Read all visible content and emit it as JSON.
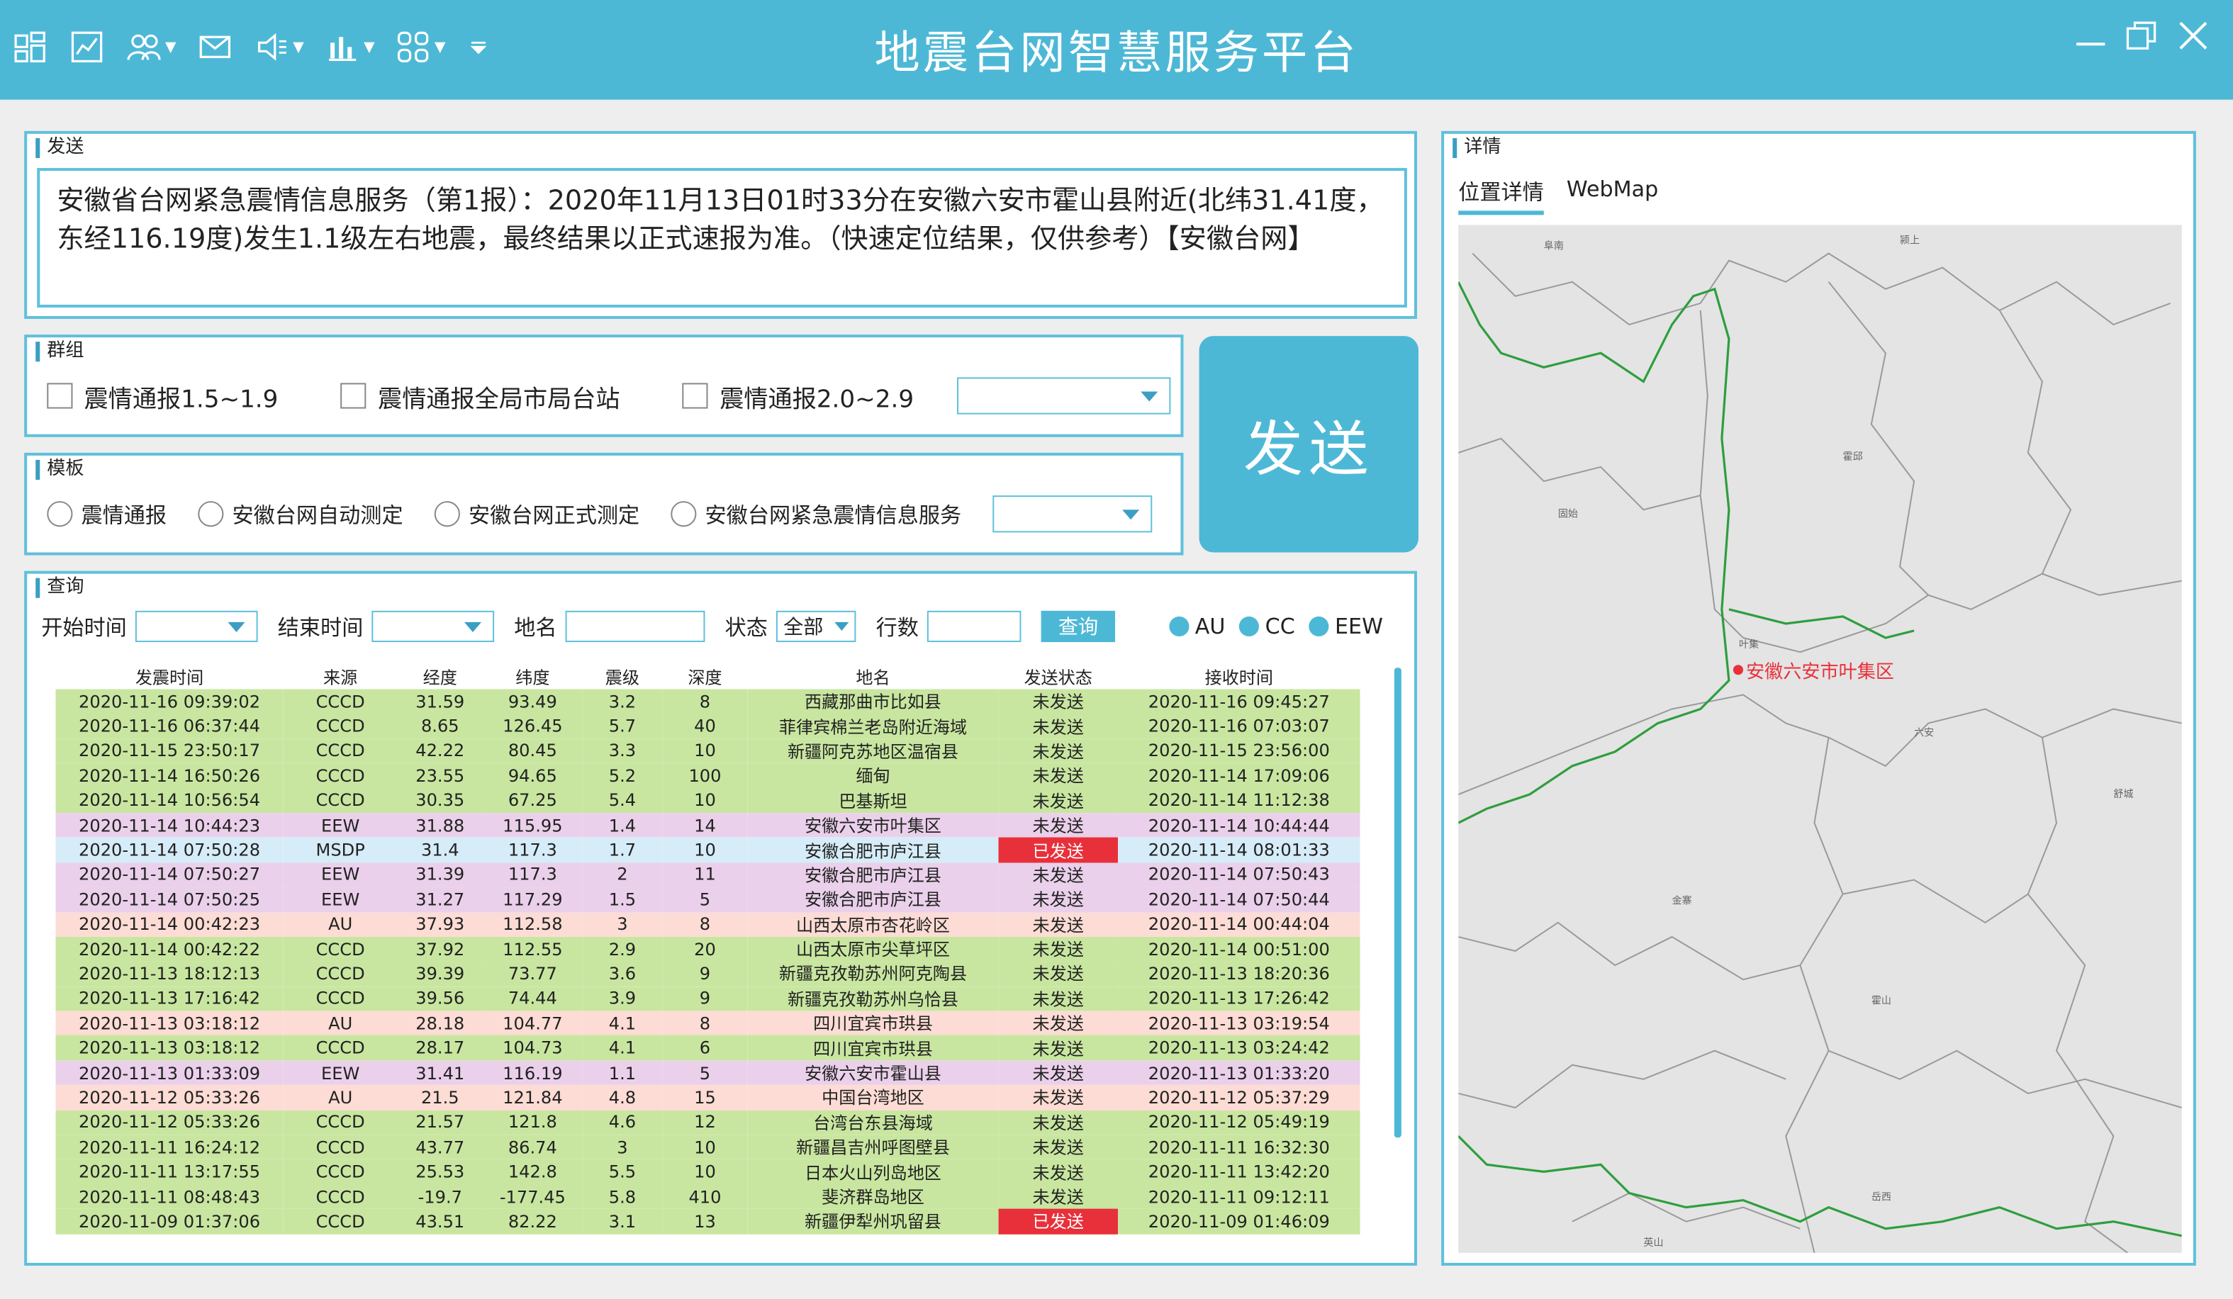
{
  "app": {
    "title": "地震台网智慧服务平台",
    "accent_color": "#4db8d6",
    "toolbar_icons": [
      "layout-icon",
      "chart-icon",
      "users-icon",
      "mail-icon",
      "speaker-icon",
      "bar-chart-icon",
      "grid-icon",
      "dropdown-icon"
    ]
  },
  "send_panel": {
    "title": "发送",
    "message": "安徽省台网紧急震情信息服务（第1报）：2020年11月13日01时33分在安徽六安市霍山县附近(北纬31.41度，东经116.19度)发生1.1级左右地震，最终结果以正式速报为准。（快速定位结果，仅供参考）【安徽台网】"
  },
  "group_panel": {
    "title": "群组",
    "options": [
      "震情通报1.5~1.9",
      "震情通报全局市局台站",
      "震情通报2.0~2.9"
    ]
  },
  "template_panel": {
    "title": "模板",
    "options": [
      "震情通报",
      "安徽台网自动测定",
      "安徽台网正式测定",
      "安徽台网紧急震情信息服务"
    ]
  },
  "send_button": {
    "label": "发送"
  },
  "query_panel": {
    "title": "查询",
    "start_label": "开始时间",
    "end_label": "结束时间",
    "place_label": "地名",
    "state_label": "状态",
    "state_value": "全部",
    "rows_label": "行数",
    "query_button": "查询",
    "legend": [
      "AU",
      "CC",
      "EEW"
    ]
  },
  "table": {
    "columns": [
      "发震时间",
      "来源",
      "经度",
      "纬度",
      "震级",
      "深度",
      "地名",
      "发送状态",
      "接收时间"
    ],
    "rows": [
      [
        "2020-11-16 09:39:02",
        "CCCD",
        "31.59",
        "93.49",
        "3.2",
        "8",
        "西藏那曲市比如县",
        "未发送",
        "2020-11-16 09:45:27"
      ],
      [
        "2020-11-16 06:37:44",
        "CCCD",
        "8.65",
        "126.45",
        "5.7",
        "40",
        "菲律宾棉兰老岛附近海域",
        "未发送",
        "2020-11-16 07:03:07"
      ],
      [
        "2020-11-15 23:50:17",
        "CCCD",
        "42.22",
        "80.45",
        "3.3",
        "10",
        "新疆阿克苏地区温宿县",
        "未发送",
        "2020-11-15 23:56:00"
      ],
      [
        "2020-11-14 16:50:26",
        "CCCD",
        "23.55",
        "94.65",
        "5.2",
        "100",
        "缅甸",
        "未发送",
        "2020-11-14 17:09:06"
      ],
      [
        "2020-11-14 10:56:54",
        "CCCD",
        "30.35",
        "67.25",
        "5.4",
        "10",
        "巴基斯坦",
        "未发送",
        "2020-11-14 11:12:38"
      ],
      [
        "2020-11-14 10:44:23",
        "EEW",
        "31.88",
        "115.95",
        "1.4",
        "14",
        "安徽六安市叶集区",
        "未发送",
        "2020-11-14 10:44:44"
      ],
      [
        "2020-11-14 07:50:28",
        "MSDP",
        "31.4",
        "117.3",
        "1.7",
        "10",
        "安徽合肥市庐江县",
        "已发送",
        "2020-11-14 08:01:33"
      ],
      [
        "2020-11-14 07:50:27",
        "EEW",
        "31.39",
        "117.3",
        "2",
        "11",
        "安徽合肥市庐江县",
        "未发送",
        "2020-11-14 07:50:43"
      ],
      [
        "2020-11-14 07:50:25",
        "EEW",
        "31.27",
        "117.29",
        "1.5",
        "5",
        "安徽合肥市庐江县",
        "未发送",
        "2020-11-14 07:50:44"
      ],
      [
        "2020-11-14 00:42:23",
        "AU",
        "37.93",
        "112.58",
        "3",
        "8",
        "山西太原市杏花岭区",
        "未发送",
        "2020-11-14 00:44:04"
      ],
      [
        "2020-11-14 00:42:22",
        "CCCD",
        "37.92",
        "112.55",
        "2.9",
        "20",
        "山西太原市尖草坪区",
        "未发送",
        "2020-11-14 00:51:00"
      ],
      [
        "2020-11-13 18:12:13",
        "CCCD",
        "39.39",
        "73.77",
        "3.6",
        "9",
        "新疆克孜勒苏州阿克陶县",
        "未发送",
        "2020-11-13 18:20:36"
      ],
      [
        "2020-11-13 17:16:42",
        "CCCD",
        "39.56",
        "74.44",
        "3.9",
        "9",
        "新疆克孜勒苏州乌恰县",
        "未发送",
        "2020-11-13 17:26:42"
      ],
      [
        "2020-11-13 03:18:12",
        "AU",
        "28.18",
        "104.77",
        "4.1",
        "8",
        "四川宜宾市珙县",
        "未发送",
        "2020-11-13 03:19:54"
      ],
      [
        "2020-11-13 03:18:12",
        "CCCD",
        "28.17",
        "104.73",
        "4.1",
        "6",
        "四川宜宾市珙县",
        "未发送",
        "2020-11-13 03:24:42"
      ],
      [
        "2020-11-13 01:33:09",
        "EEW",
        "31.41",
        "116.19",
        "1.1",
        "5",
        "安徽六安市霍山县",
        "未发送",
        "2020-11-13 01:33:20"
      ],
      [
        "2020-11-12 05:33:26",
        "AU",
        "21.5",
        "121.84",
        "4.8",
        "15",
        "中国台湾地区",
        "未发送",
        "2020-11-12 05:37:29"
      ],
      [
        "2020-11-12 05:33:26",
        "CCCD",
        "21.57",
        "121.8",
        "4.6",
        "12",
        "台湾台东县海域",
        "未发送",
        "2020-11-12 05:49:19"
      ],
      [
        "2020-11-11 16:24:12",
        "CCCD",
        "43.77",
        "86.74",
        "3",
        "10",
        "新疆昌吉州呼图壁县",
        "未发送",
        "2020-11-11 16:32:30"
      ],
      [
        "2020-11-11 13:17:55",
        "CCCD",
        "25.53",
        "142.8",
        "5.5",
        "10",
        "日本火山列岛地区",
        "未发送",
        "2020-11-11 13:42:20"
      ],
      [
        "2020-11-11 08:48:43",
        "CCCD",
        "-19.7",
        "-177.45",
        "5.8",
        "410",
        "斐济群岛地区",
        "未发送",
        "2020-11-11 09:12:11"
      ],
      [
        "2020-11-09 01:37:06",
        "CCCD",
        "43.51",
        "82.22",
        "3.1",
        "13",
        "新疆伊犁州巩留县",
        "已发送",
        "2020-11-09 01:46:09"
      ]
    ],
    "source_colors": {
      "CCCD": "#c8e6a0",
      "EEW": "#ead0ea",
      "MSDP": "#d6ecf8",
      "AU": "#fcdcd4"
    },
    "sent_color": "#e8303a"
  },
  "detail_panel": {
    "title": "详情",
    "tabs": [
      "位置详情",
      "WebMap"
    ],
    "marker_label": "安徽六安市叶集区",
    "map_place_labels": [
      "阜南",
      "固始",
      "霍邱",
      "叶集",
      "金寨",
      "霍山",
      "岳西",
      "英山",
      "六安",
      "颍上",
      "舒城"
    ]
  }
}
